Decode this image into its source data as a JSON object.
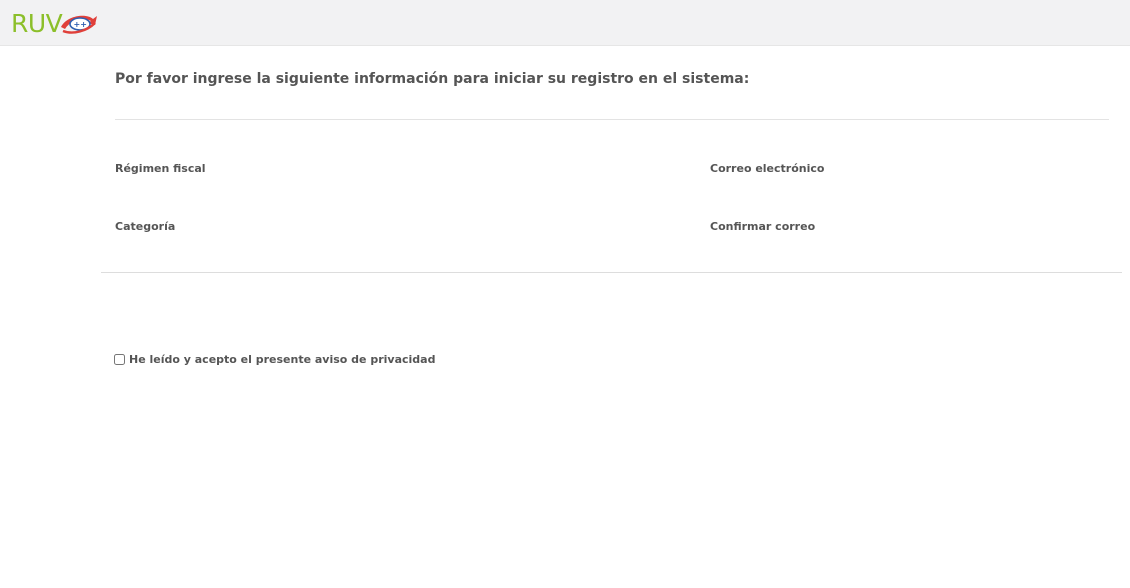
{
  "header": {
    "logo_text": "RUV",
    "logo_icon": "ruv-swoosh-logo-icon",
    "colors": {
      "background": "#f2f2f3",
      "logo_green": "#8cbf2a",
      "logo_red": "#e0403a",
      "logo_blue": "#2f5fb0"
    }
  },
  "form": {
    "intro": "Por favor ingrese la siguiente información para iniciar su registro en el sistema:",
    "fields": {
      "regimen_fiscal": "Régimen fiscal",
      "correo_electronico": "Correo electrónico",
      "categoria": "Categoría",
      "confirmar_correo": "Confirmar correo"
    },
    "privacy": {
      "label": "He leído y acepto el presente aviso de privacidad",
      "checked": false
    }
  }
}
